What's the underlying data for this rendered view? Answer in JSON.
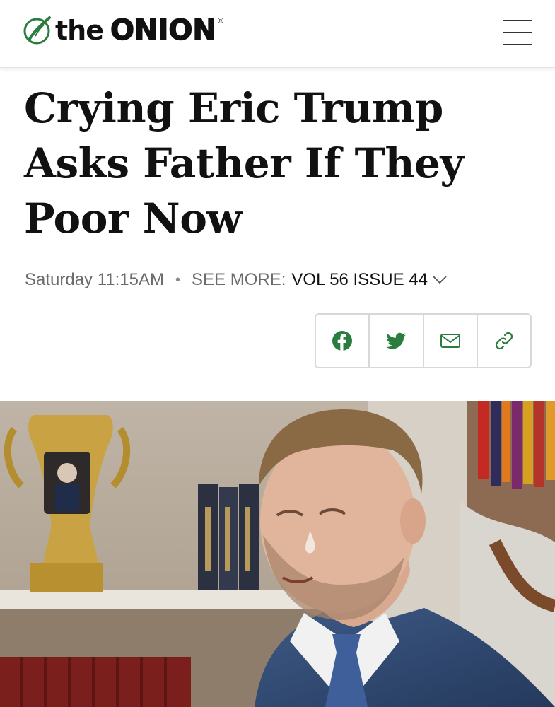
{
  "header": {
    "logo_the": "the",
    "logo_onion": "ONION",
    "logo_reg": "®",
    "menu_icon": "hamburger-menu-icon"
  },
  "article": {
    "headline": "Crying Eric Trump Asks Father If They Poor Now",
    "date": "Saturday 11:15AM",
    "separator": "•",
    "see_more_label": "SEE MORE:",
    "issue": "VOL 56 ISSUE 44"
  },
  "share": {
    "buttons": [
      {
        "icon": "facebook-icon",
        "color": "#2b7d3f"
      },
      {
        "icon": "twitter-icon",
        "color": "#2b7d3f"
      },
      {
        "icon": "mail-icon",
        "color": "#2b7d3f"
      },
      {
        "icon": "link-icon",
        "color": "#2b7d3f"
      }
    ]
  },
  "colors": {
    "brand_green": "#2b7d3f",
    "text": "#111111",
    "muted": "#6b6b6b"
  }
}
